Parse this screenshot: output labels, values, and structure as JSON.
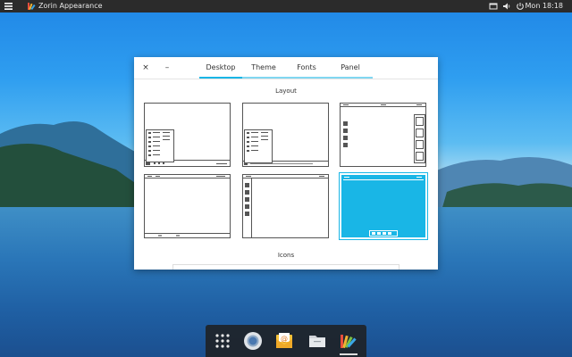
{
  "topbar": {
    "app_title": "Zorin Appearance",
    "clock": "Mon 18:18",
    "indicators": [
      "window-icon",
      "volume-icon",
      "power-icon"
    ]
  },
  "window": {
    "close_glyph": "×",
    "minimize_glyph": "–",
    "tabs": [
      {
        "label": "Desktop",
        "active": true
      },
      {
        "label": "Theme",
        "active": false
      },
      {
        "label": "Fonts",
        "active": false
      },
      {
        "label": "Panel",
        "active": false
      }
    ],
    "layout_section_title": "Layout",
    "icons_section_title": "Icons",
    "layouts": [
      {
        "name": "layout-windows-classic",
        "selected": false
      },
      {
        "name": "layout-windows-fullbar",
        "selected": false
      },
      {
        "name": "layout-macos-dock",
        "selected": false
      },
      {
        "name": "layout-gnome-classic",
        "selected": false
      },
      {
        "name": "layout-ubuntu-sidebar",
        "selected": false
      },
      {
        "name": "layout-zorin-dock",
        "selected": true
      }
    ]
  },
  "dock": {
    "items": [
      "app-grid-icon",
      "chromium-icon",
      "mail-icon",
      "files-icon",
      "zorin-appearance-icon"
    ]
  },
  "colors": {
    "accent": "#19b6e6",
    "topbar": "#2b2b2b",
    "dock": "#1e1e1e"
  }
}
